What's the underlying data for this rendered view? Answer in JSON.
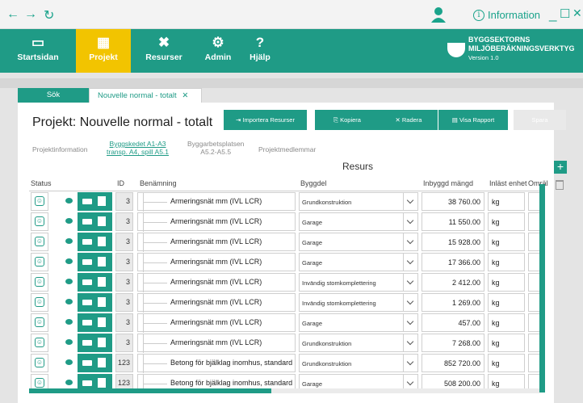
{
  "window": {
    "back": "←",
    "forward": "→",
    "refresh": "↻",
    "info_label": "Information",
    "minimize": "_",
    "maximize": "☐",
    "close": "✕"
  },
  "nav": {
    "items": [
      {
        "label": "Startsidan",
        "icon": "home-icon"
      },
      {
        "label": "Projekt",
        "icon": "chart-icon"
      },
      {
        "label": "Resurser",
        "icon": "tools-icon"
      },
      {
        "label": "Admin",
        "icon": "gear-icon"
      },
      {
        "label": "Hjälp",
        "icon": "help-icon"
      }
    ],
    "active": "Projekt",
    "brand_line1": "BYGGSEKTORNS",
    "brand_line2": "MILJÖBERÄKNINGSVERKTYG",
    "brand_version": "Version 1.0"
  },
  "tabs": [
    {
      "label": "Sök"
    },
    {
      "label": "Nouvelle normal - totalt"
    }
  ],
  "page": {
    "title": "Projekt: Nouvelle normal - totalt"
  },
  "toolbar": {
    "import": "Importera Resurser",
    "copy": "Kopiera",
    "delete": "Radera",
    "report": "Visa Rapport",
    "save": "Spara"
  },
  "subtabs": {
    "info": "Projektinformation",
    "byggskedet_line1": "Byggskedet A1-A3",
    "byggskedet_line2": "transp. A4, spill A5.1",
    "byggarbetsplatsen_line1": "Byggarbetsplatsen",
    "byggarbetsplatsen_line2": "A5.2-A5.5",
    "medlemmar": "Projektmedlemmar"
  },
  "table": {
    "group_header": "Resurs",
    "columns": {
      "status": "Status",
      "id": "ID",
      "name": "Benämning",
      "byggdel": "Byggdel",
      "mangd": "Inbyggd mängd",
      "enhet": "Inläst enhet",
      "omr": "Omräl"
    },
    "rows": [
      {
        "id": "3",
        "name": "Armeringsnät mm (IVL LCR)",
        "byggdel": "Grundkonstruktion",
        "mangd": "38 760.00",
        "enhet": "kg"
      },
      {
        "id": "3",
        "name": "Armeringsnät mm (IVL LCR)",
        "byggdel": "Garage",
        "mangd": "11 550.00",
        "enhet": "kg"
      },
      {
        "id": "3",
        "name": "Armeringsnät mm (IVL LCR)",
        "byggdel": "Garage",
        "mangd": "15 928.00",
        "enhet": "kg"
      },
      {
        "id": "3",
        "name": "Armeringsnät mm (IVL LCR)",
        "byggdel": "Garage",
        "mangd": "17 366.00",
        "enhet": "kg"
      },
      {
        "id": "3",
        "name": "Armeringsnät mm (IVL LCR)",
        "byggdel": "Invändig stomkomplettering",
        "mangd": "2 412.00",
        "enhet": "kg"
      },
      {
        "id": "3",
        "name": "Armeringsnät mm (IVL LCR)",
        "byggdel": "Invändig stomkomplettering",
        "mangd": "1 269.00",
        "enhet": "kg"
      },
      {
        "id": "3",
        "name": "Armeringsnät mm (IVL LCR)",
        "byggdel": "Garage",
        "mangd": "457.00",
        "enhet": "kg"
      },
      {
        "id": "3",
        "name": "Armeringsnät mm (IVL LCR)",
        "byggdel": "Grundkonstruktion",
        "mangd": "7 268.00",
        "enhet": "kg"
      },
      {
        "id": "123",
        "name": "Betong för bjälklag inomhus, standard",
        "byggdel": "Grundkonstruktion",
        "mangd": "852 720.00",
        "enhet": "kg"
      },
      {
        "id": "123",
        "name": "Betong för bjälklag inomhus, standard",
        "byggdel": "Garage",
        "mangd": "508 200.00",
        "enhet": "kg"
      }
    ]
  },
  "actions": {
    "add": "+"
  },
  "colors": {
    "primary": "#1f9b86",
    "active_nav": "#f2c400"
  }
}
